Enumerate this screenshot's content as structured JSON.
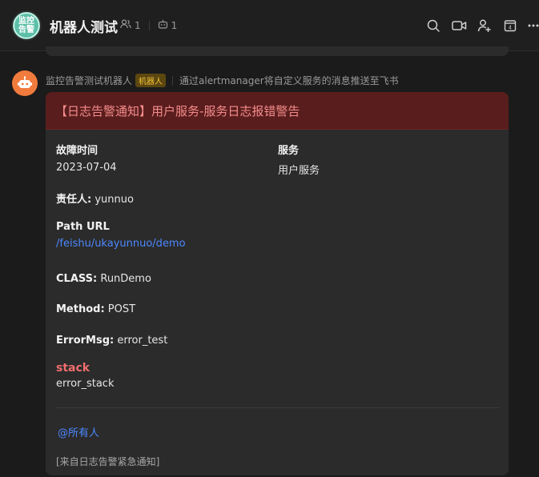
{
  "header": {
    "group_avatar_text": "监控告警",
    "group_avatar_line1": "监控",
    "group_avatar_line2": "告警",
    "title": "机器人测试",
    "member_count": "1",
    "bot_count": "1",
    "icons": [
      "search-icon",
      "video-icon",
      "add-member-icon",
      "calendar-icon",
      "more-icon"
    ],
    "calendar_day": "4"
  },
  "message": {
    "sender": "监控告警测试机器人",
    "bot_tag": "机器人",
    "subtitle": "通过alertmanager将自定义服务的消息推送至飞书"
  },
  "card": {
    "title": "【日志告警通知】用户服务-服务日志报错警告",
    "fault_time_label": "故障时间",
    "fault_time_value": "2023-07-04",
    "service_label": "服务",
    "service_value": "用户服务",
    "owner_label": "责任人:",
    "owner_value": " yunnuo",
    "path_label": "Path URL",
    "path_value": "/feishu/ukayunnuo/demo",
    "class_label": "CLASS:",
    "class_value": " RunDemo",
    "method_label": "Method:",
    "method_value": " POST",
    "errormsg_label": "ErrorMsg:",
    "errormsg_value": " error_test",
    "stack_label": "stack",
    "stack_value": "error_stack",
    "mention": "@所有人",
    "footer": "[来自日志告警紧急通知]"
  },
  "colors": {
    "accent_link": "#4c88ff",
    "card_header_bg": "#5a1d1d",
    "card_title": "#f48c8c",
    "bot_tag_bg": "#5c4710",
    "bot_tag_text": "#f3c238",
    "bot_avatar": "#f17b3d"
  }
}
